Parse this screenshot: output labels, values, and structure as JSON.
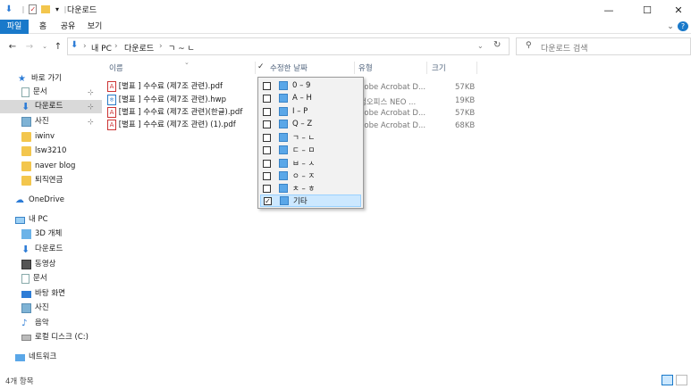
{
  "window": {
    "title": "다운로드",
    "min": "—",
    "max": "☐",
    "close": "✕"
  },
  "ribbon": {
    "tabs": [
      "파일",
      "홈",
      "공유",
      "보기"
    ],
    "expand": "⌄",
    "help": "?"
  },
  "address": {
    "path": [
      "내 PC",
      "다운로드",
      "ㄱ ~ ㄴ"
    ],
    "sep": "›",
    "refresh": "↻",
    "search_placeholder": "다운로드 검색"
  },
  "sidebar": {
    "quick_access": "바로 가기",
    "items": [
      {
        "label": "문서",
        "pinned": true
      },
      {
        "label": "다운로드",
        "pinned": true,
        "selected": true
      },
      {
        "label": "사진",
        "pinned": true
      },
      {
        "label": "iwinv"
      },
      {
        "label": "lsw3210"
      },
      {
        "label": "naver blog"
      },
      {
        "label": "퇴직연금"
      }
    ],
    "onedrive": "OneDrive",
    "this_pc": "내 PC",
    "pc_items": [
      "3D 개체",
      "다운로드",
      "동영상",
      "문서",
      "바탕 화면",
      "사진",
      "음악",
      "로컬 디스크 (C:)"
    ],
    "network": "네트워크",
    "pin_glyph": "📌"
  },
  "columns": {
    "name": "이름",
    "date": "수정한 날짜",
    "type": "유형",
    "size": "크기"
  },
  "files": [
    {
      "name": "[별표 ] 수수료 (제7조 관련).pdf",
      "icon": "pdf",
      "type": "dobe Acrobat D...",
      "size": "57KB"
    },
    {
      "name": "[별표 ] 수수료 (제7조 관련).hwp",
      "icon": "hwp",
      "type": "컴오피스 NEO ...",
      "size": "19KB"
    },
    {
      "name": "[별표 ] 수수료 (제7조 관련)(한글).pdf",
      "icon": "pdf",
      "type": "dobe Acrobat D...",
      "size": "57KB"
    },
    {
      "name": "[별표 ] 수수료 (제7조 관련) (1).pdf",
      "icon": "pdf",
      "type": "dobe Acrobat D...",
      "size": "68KB"
    }
  ],
  "filter": {
    "options": [
      {
        "label": "0 – 9",
        "checked": false
      },
      {
        "label": "A – H",
        "checked": false
      },
      {
        "label": "I – P",
        "checked": false
      },
      {
        "label": "Q – Z",
        "checked": false
      },
      {
        "label": "ㄱ – ㄴ",
        "checked": false
      },
      {
        "label": "ㄷ – ㅁ",
        "checked": false
      },
      {
        "label": "ㅂ – ㅅ",
        "checked": false
      },
      {
        "label": "ㅇ – ㅈ",
        "checked": false
      },
      {
        "label": "ㅊ – ㅎ",
        "checked": false
      },
      {
        "label": "기타",
        "checked": true
      }
    ],
    "check_glyph": "✓"
  },
  "status": {
    "count": "4개 항목"
  },
  "colors": {
    "accent": "#1979ca",
    "folder": "#f3c64d",
    "selected_bg": "#cce8ff"
  }
}
